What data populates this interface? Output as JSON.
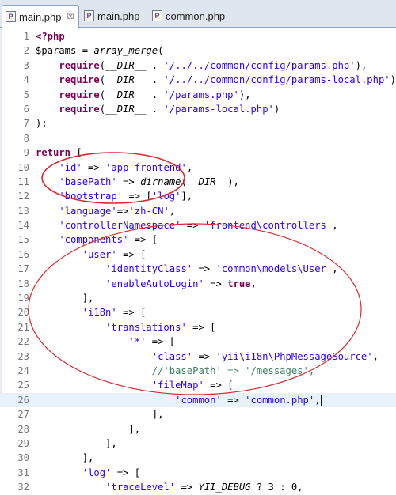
{
  "tabs": [
    {
      "label": "main.php",
      "active": true,
      "close_glyph": "☒"
    },
    {
      "label": "main.php",
      "active": false
    },
    {
      "label": "common.php",
      "active": false
    }
  ],
  "lines": [
    {
      "n": "1",
      "html": "<span class=\"kw\">&lt;?php</span>"
    },
    {
      "n": "2",
      "html": "$params = <span class=\"it\">array_merge</span>("
    },
    {
      "n": "3",
      "html": "    <span class=\"kw\">require</span>(<span class=\"it\">__DIR__</span> . <span class=\"st\">'/../../common/config/params.php'</span>),"
    },
    {
      "n": "4",
      "html": "    <span class=\"kw\">require</span>(<span class=\"it\">__DIR__</span> . <span class=\"st\">'/../../common/config/params-local.php'</span>),"
    },
    {
      "n": "5",
      "html": "    <span class=\"kw\">require</span>(<span class=\"it\">__DIR__</span> . <span class=\"st\">'/params.php'</span>),"
    },
    {
      "n": "6",
      "html": "    <span class=\"kw\">require</span>(<span class=\"it\">__DIR__</span> . <span class=\"st\">'/params-local.php'</span>)"
    },
    {
      "n": "7",
      "html": ");"
    },
    {
      "n": "8",
      "html": ""
    },
    {
      "n": "9",
      "html": "<span class=\"kw\">return</span> ["
    },
    {
      "n": "10",
      "html": "    <span class=\"st\">'id'</span> =&gt; <span class=\"st\">'app-frontend'</span>,"
    },
    {
      "n": "11",
      "html": "    <span class=\"st\">'basePath'</span> =&gt; <span class=\"it\">dirname</span>(<span class=\"it\">__DIR__</span>),"
    },
    {
      "n": "12",
      "html": "    <span class=\"st\">'bootstrap'</span> =&gt; [<span class=\"st\">'log'</span>],"
    },
    {
      "n": "13",
      "html": "    <span class=\"st\">'language'</span>=&gt;<span class=\"st\">'zh-CN'</span>,"
    },
    {
      "n": "14",
      "html": "    <span class=\"st\">'controllerNamespace'</span> =&gt; <span class=\"st\">'frontend\\controllers'</span>,"
    },
    {
      "n": "15",
      "html": "    <span class=\"st\">'components'</span> =&gt; ["
    },
    {
      "n": "16",
      "html": "        <span class=\"st\">'user'</span> =&gt; ["
    },
    {
      "n": "17",
      "html": "            <span class=\"st\">'identityClass'</span> =&gt; <span class=\"st\">'common\\models\\User'</span>,"
    },
    {
      "n": "18",
      "html": "            <span class=\"st\">'enableAutoLogin'</span> =&gt; <span class=\"kw\">true</span>,"
    },
    {
      "n": "19",
      "html": "        ],"
    },
    {
      "n": "20",
      "html": "        <span class=\"st\">'i18n'</span> =&gt; ["
    },
    {
      "n": "21",
      "html": "            <span class=\"st\">'translations'</span> =&gt; ["
    },
    {
      "n": "22",
      "html": "                <span class=\"st\">'*'</span> =&gt; ["
    },
    {
      "n": "23",
      "html": "                    <span class=\"st\">'class'</span> =&gt; <span class=\"st\">'yii\\i18n\\PhpMessageSource'</span>,"
    },
    {
      "n": "24",
      "html": "                    <span class=\"cm\">//'basePath' =&gt; '/messages',</span>"
    },
    {
      "n": "25",
      "html": "                    <span class=\"st\">'fileMap'</span> =&gt; ["
    },
    {
      "n": "26",
      "html": "                        <span class=\"st\">'common'</span> =&gt; <span class=\"st\">'common.php'</span>,<span class=\"caret\"></span>"
    },
    {
      "n": "27",
      "html": "                    ],"
    },
    {
      "n": "28",
      "html": "                ],"
    },
    {
      "n": "29",
      "html": "            ],"
    },
    {
      "n": "30",
      "html": "        ],"
    },
    {
      "n": "31",
      "html": "        <span class=\"st\">'log'</span> =&gt; ["
    },
    {
      "n": "32",
      "html": "            <span class=\"st\">'traceLevel'</span> =&gt; <span class=\"it\">YII_DEBUG</span> ? 3 : 0,"
    }
  ],
  "current_line": "26",
  "annotation_color": "#d9282f"
}
